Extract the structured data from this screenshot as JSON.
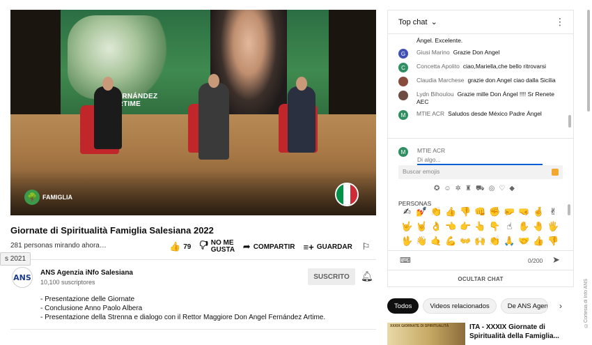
{
  "video": {
    "banner_text": "FERNÁNDEZ ARTIME",
    "logo_text": "FAMIGLIA",
    "flag_colors": [
      "#009246",
      "#ffffff",
      "#ce2b37"
    ]
  },
  "title": "Giornate di Spiritualità Famiglia Salesiana 2022",
  "views": "281 personas mirando ahora…",
  "date_pill": "s 2021",
  "actions": {
    "like_count": "79",
    "dislike_label": "NO ME GUSTA",
    "share_label": "COMPARTIR",
    "save_label": "GUARDAR"
  },
  "channel": {
    "avatar_text": "ANS",
    "name": "ANS Agenzia iNfo Salesiana",
    "subscribers": "10,100 suscriptores",
    "subscribe_label": "SUSCRITO"
  },
  "description": [
    "- Presentazione delle Giornate",
    "- Conclusione Anno Paolo Albera",
    "- Presentazione della Strenna e dialogo con il Rettor Maggiore Don Angel Fernández Artime."
  ],
  "chat": {
    "header": "Top chat",
    "first_line": "Ángel. Excelente.",
    "messages": [
      {
        "initial": "G",
        "color": "#3f51b5",
        "author": "Giusi Marino",
        "text": "Grazie Don Angel"
      },
      {
        "initial": "C",
        "color": "#2f8f62",
        "author": "Concetta Apolito",
        "text": "ciao,Mariella,che bello ritrovarsi"
      },
      {
        "initial": "",
        "color": "#8a4b3f",
        "author": "Claudia Marchese",
        "text": "grazie don Angel ciao dalla Sicilia"
      },
      {
        "initial": "",
        "color": "#6d4c41",
        "author": "Lydn Bihoulou",
        "text": "Grazie mille Don Ángel !!!! Sr Renete AEC"
      },
      {
        "initial": "M",
        "color": "#2f8f62",
        "author": "MTIE ACR",
        "text": "Saludos desde México Padre Ángel"
      }
    ],
    "me_initial": "M",
    "me_name": "MTIE ACR",
    "input_placeholder": "Di algo...",
    "emoji_search_placeholder": "Buscar emojis",
    "emoji_section": "PERSONAS",
    "emoji_categories": [
      "✪",
      "☺",
      "✲",
      "♜",
      "⛟",
      "◎",
      "♡",
      "◆"
    ],
    "emojis": [
      "✍",
      "💅",
      "👏",
      "👍",
      "👎",
      "👊",
      "✊",
      "🤛",
      "🤜",
      "🤞",
      "✌",
      "🤟",
      "🤘",
      "👌",
      "👈",
      "👉",
      "👆",
      "👇",
      "☝",
      "✋",
      "🤚",
      "🖐",
      "🖖",
      "👋",
      "🤙",
      "💪",
      "👐",
      "🙌",
      "👏",
      "🙏",
      "🤝",
      "👍",
      "👎"
    ],
    "char_count": "0/200",
    "hide_chat_label": "OCULTAR CHAT"
  },
  "chips": [
    "Todos",
    "Videos relacionados",
    "De ANS Agenzia"
  ],
  "related": {
    "thumb_text": "XXXIX GIORNATE DI SPIRITUALITÀ",
    "title": "ITA - XXXIX Giornate di Spiritualità della Famiglia..."
  },
  "credit": "©Cortesia di Info ANS"
}
